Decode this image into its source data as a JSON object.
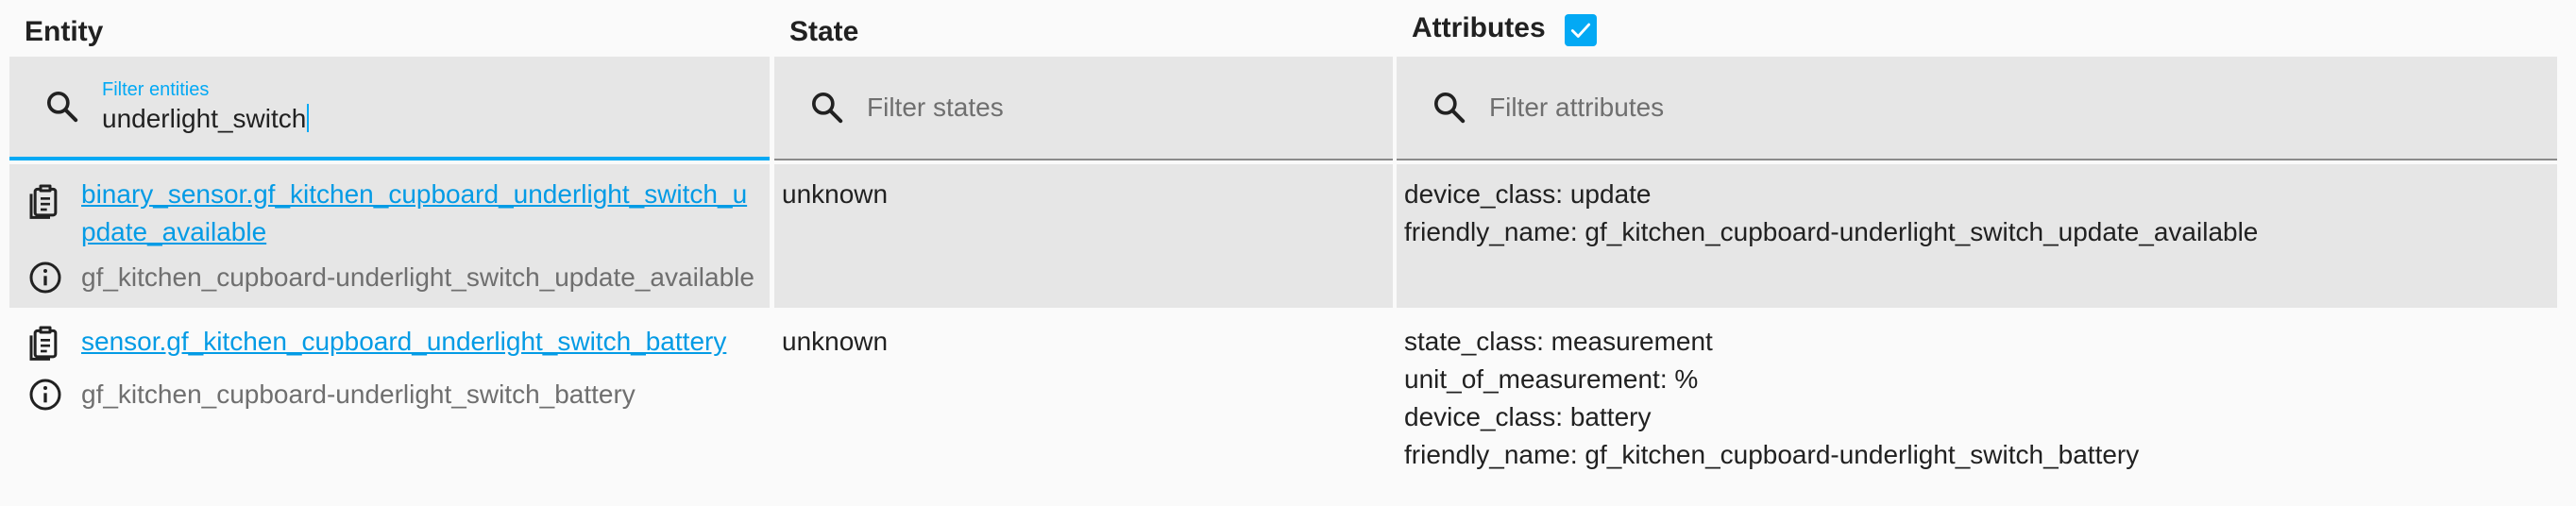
{
  "headers": {
    "entity": "Entity",
    "state": "State",
    "attributes": "Attributes",
    "attributes_checked": true
  },
  "filters": {
    "entity": {
      "label": "Filter entities",
      "value": "underlight_switch"
    },
    "state": {
      "placeholder": "Filter states"
    },
    "attributes": {
      "placeholder": "Filter attributes"
    }
  },
  "rows": [
    {
      "entity_id": "binary_sensor.gf_kitchen_cupboard_underlight_switch_update_available",
      "friendly_name": "gf_kitchen_cupboard-underlight_switch_update_available",
      "state": "unknown",
      "attributes": [
        "device_class: update",
        "friendly_name: gf_kitchen_cupboard-underlight_switch_update_available"
      ]
    },
    {
      "entity_id": "sensor.gf_kitchen_cupboard_underlight_switch_battery",
      "friendly_name": "gf_kitchen_cupboard-underlight_switch_battery",
      "state": "unknown",
      "attributes": [
        "state_class: measurement",
        "unit_of_measurement: %",
        "device_class: battery",
        "friendly_name: gf_kitchen_cupboard-underlight_switch_battery"
      ]
    }
  ],
  "colors": {
    "accent": "#03a9f4",
    "link": "#039be5",
    "row_alt": "#e6e6e6",
    "muted_text": "#6f6f6f"
  },
  "icons": {
    "search": "search-icon",
    "clipboard": "clipboard-icon",
    "info": "info-icon",
    "check": "check-icon"
  }
}
